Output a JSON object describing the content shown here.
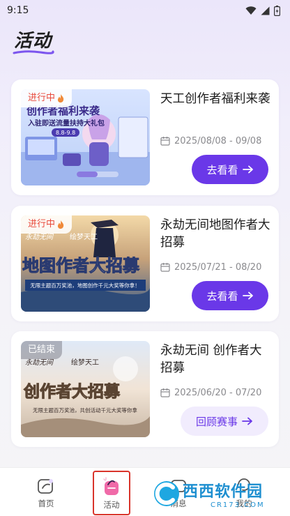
{
  "status_bar": {
    "time": "9:15"
  },
  "header": {
    "title": "活动"
  },
  "events": [
    {
      "status": "进行中",
      "title": "天工创作者福利来袭",
      "date": "2025/08/08 - 09/08",
      "action": "去看看",
      "banner": {
        "headline": "创作者福利来袭",
        "sub": "入驻即送流量扶持大礼包",
        "range": "8.8-9.8"
      }
    },
    {
      "status": "进行中",
      "title": "永劫无间地图作者大招募",
      "date": "2025/07/21 - 08/20",
      "action": "去看看",
      "banner": {
        "logo": "永劫无间",
        "partner": "绘梦天工",
        "headline": "地图作者大招募",
        "sub": "无限主题百万奖池，地图创作千元大奖等你拿！"
      }
    },
    {
      "status": "已结束",
      "title": "永劫无间 创作者大招募",
      "date": "2025/06/20 - 07/20",
      "action": "回顾赛事",
      "banner": {
        "logo": "永劫无间",
        "partner": "绘梦天工",
        "headline": "创作者大招募",
        "sub": "无限主题百万奖池，共创活动千元大奖等你拿"
      }
    }
  ],
  "nav": [
    {
      "label": "首页"
    },
    {
      "label": "活动"
    },
    {
      "label": "消息"
    },
    {
      "label": "我的"
    }
  ],
  "watermark": {
    "brand": "西西软件园",
    "domain": "CR173.COM"
  },
  "colors": {
    "accent": "#6a38e8",
    "active_status": "#e8493b"
  }
}
